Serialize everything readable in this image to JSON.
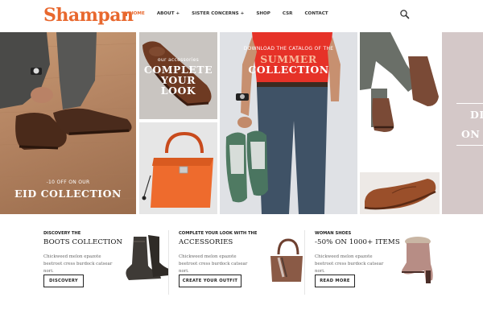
{
  "brand": {
    "logo_text": "Shampan",
    "accent_color": "#e8682e"
  },
  "nav": {
    "items": [
      {
        "label": "HOME",
        "active": true,
        "icon": "home-icon"
      },
      {
        "label": "ABOUT +"
      },
      {
        "label": "SISTER CONCERNS +"
      },
      {
        "label": "SHOP"
      },
      {
        "label": "CSR"
      },
      {
        "label": "CONTACT"
      }
    ],
    "search_icon": "search-icon"
  },
  "hero": {
    "panel_eid": {
      "small": "-10 OFF ON OUR",
      "big": "EID COLLECTION"
    },
    "panel_accessories": {
      "small": "our accessories",
      "big_line1": "COMPLETE",
      "big_line2": "YOUR",
      "big_line3": "LOOK"
    },
    "panel_catalog": {
      "small": "DOWNLOAD THE CATALOG OF THE",
      "big_line1": "SUMMER",
      "big_line2": "COLLECTION"
    },
    "panel_right": {
      "line1": "DI",
      "line2": "ON"
    }
  },
  "promos": [
    {
      "subtitle": "DISCOVERY THE",
      "title": "BOOTS COLLECTION",
      "text": "Chickweed melon epazote beetroot cress burdock catsear nori.",
      "button": "DISCOVERY"
    },
    {
      "subtitle": "COMPLETE YOUR LOOK WITH THE",
      "title": "ACCESSORIES",
      "text": "Chickweed melon epazote beetroot cress burdock catsear nori.",
      "button": "CREATE YOUR OUTFIT"
    },
    {
      "subtitle": "WOMAN SHOES",
      "title": "-50% ON 1000+ ITEMS",
      "text": "Chickweed melon epazote beetroot cress burdock catsear nori.",
      "button": "READ MORE"
    }
  ]
}
